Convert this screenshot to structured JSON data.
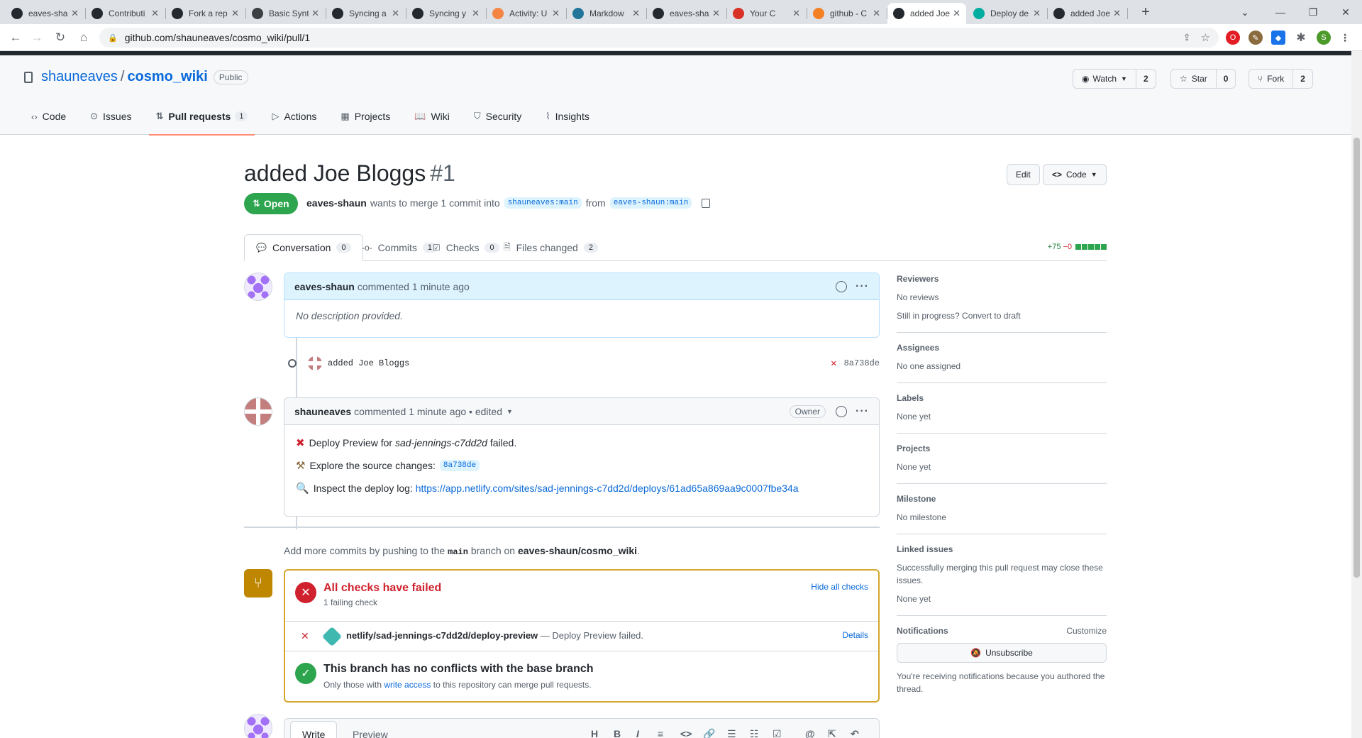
{
  "browser": {
    "tabs": [
      {
        "title": "eaves-sha",
        "fav": "github-icon",
        "color": "#24292f"
      },
      {
        "title": "Contributi",
        "fav": "github-icon",
        "color": "#24292f"
      },
      {
        "title": "Fork a rep",
        "fav": "github-icon",
        "color": "#24292f"
      },
      {
        "title": "Basic Synt",
        "fav": "markdown-icon",
        "color": "#3c4043"
      },
      {
        "title": "Syncing a",
        "fav": "github-icon",
        "color": "#24292f"
      },
      {
        "title": "Syncing y",
        "fav": "github-icon",
        "color": "#24292f"
      },
      {
        "title": "Activity: U",
        "fav": "activity-icon",
        "color": "#f48542"
      },
      {
        "title": "Markdow",
        "fav": "wordpress-icon",
        "color": "#21759b"
      },
      {
        "title": "eaves-sha",
        "fav": "github-icon",
        "color": "#24292f"
      },
      {
        "title": "Your C",
        "fav": "gmail-icon",
        "color": "#d93025"
      },
      {
        "title": "github - C",
        "fav": "stackoverflow-icon",
        "color": "#f48024"
      },
      {
        "title": "added Joe",
        "fav": "github-icon",
        "color": "#24292f",
        "active": true
      },
      {
        "title": "Deploy de",
        "fav": "netlify-icon",
        "color": "#00ad9f"
      },
      {
        "title": "added Joe",
        "fav": "github-icon",
        "color": "#24292f"
      }
    ],
    "url": "github.com/shauneaves/cosmo_wiki/pull/1",
    "profile_initial": "S"
  },
  "repo": {
    "owner": "shauneaves",
    "name": "cosmo_wiki",
    "visibility": "Public",
    "watch_label": "Watch",
    "watch_count": "2",
    "star_label": "Star",
    "star_count": "0",
    "fork_label": "Fork",
    "fork_count": "2",
    "nav": [
      {
        "label": "Code",
        "icon": "code-icon"
      },
      {
        "label": "Issues",
        "icon": "issue-icon"
      },
      {
        "label": "Pull requests",
        "icon": "pull-request-icon",
        "count": "1",
        "selected": true
      },
      {
        "label": "Actions",
        "icon": "play-icon"
      },
      {
        "label": "Projects",
        "icon": "table-icon"
      },
      {
        "label": "Wiki",
        "icon": "book-icon"
      },
      {
        "label": "Security",
        "icon": "shield-icon"
      },
      {
        "label": "Insights",
        "icon": "graph-icon"
      }
    ]
  },
  "pr": {
    "title": "added Joe Bloggs",
    "number": "#1",
    "edit_label": "Edit",
    "code_label": "Code",
    "state": "Open",
    "author": "eaves-shaun",
    "merge_text_1": "wants to merge 1 commit into",
    "base_branch": "shauneaves:main",
    "merge_text_2": "from",
    "head_branch": "eaves-shaun:main",
    "tabs": [
      {
        "label": "Conversation",
        "count": "0",
        "icon": "comment-icon",
        "selected": true
      },
      {
        "label": "Commits",
        "count": "1",
        "icon": "commit-icon"
      },
      {
        "label": "Checks",
        "count": "0",
        "icon": "checklist-icon"
      },
      {
        "label": "Files changed",
        "count": "2",
        "icon": "file-diff-icon"
      }
    ],
    "additions": "+75",
    "deletions": "−0"
  },
  "timeline": {
    "comment1": {
      "author": "eaves-shaun",
      "meta": "commented 1 minute ago",
      "body": "No description provided."
    },
    "commit": {
      "message": "added Joe Bloggs",
      "sha": "8a738de"
    },
    "comment2": {
      "author": "shauneaves",
      "meta": "commented 1 minute ago • edited",
      "role": "Owner",
      "line1_prefix": "Deploy Preview for",
      "line1_site": "sad-jennings-c7dd2d",
      "line1_suffix": "failed.",
      "line2_prefix": "Explore the source changes:",
      "line2_sha": "8a738de",
      "line3_prefix": "Inspect the deploy log:",
      "line3_link": "https://app.netlify.com/sites/sad-jennings-c7dd2d/deploys/61ad65a869aa9c0007fbe34a"
    },
    "add_more_1": "Add more commits by pushing to the",
    "add_more_branch": "main",
    "add_more_2": "branch on",
    "add_more_repo": "eaves-shaun/cosmo_wiki",
    "add_more_3": "."
  },
  "merge": {
    "checks_title": "All checks have failed",
    "checks_sub": "1 failing check",
    "hide_label": "Hide all checks",
    "check_name": "netlify/sad-jennings-c7dd2d/deploy-preview",
    "check_desc": "— Deploy Preview failed.",
    "details_label": "Details",
    "conflict_title": "This branch has no conflicts with the base branch",
    "conflict_sub_1": "Only those with",
    "conflict_link": "write access",
    "conflict_sub_2": "to this repository can merge pull requests."
  },
  "sidebar": {
    "reviewers_title": "Reviewers",
    "reviewers_value": "No reviews",
    "reviewers_draft": "Still in progress? Convert to draft",
    "assignees_title": "Assignees",
    "assignees_value": "No one assigned",
    "labels_title": "Labels",
    "labels_value": "None yet",
    "projects_title": "Projects",
    "projects_value": "None yet",
    "milestone_title": "Milestone",
    "milestone_value": "No milestone",
    "linked_title": "Linked issues",
    "linked_desc": "Successfully merging this pull request may close these issues.",
    "linked_value": "None yet",
    "notif_title": "Notifications",
    "notif_customize": "Customize",
    "unsubscribe_label": "Unsubscribe",
    "notif_reason": "You're receiving notifications because you authored the thread."
  },
  "composer": {
    "write_tab": "Write",
    "preview_tab": "Preview"
  }
}
